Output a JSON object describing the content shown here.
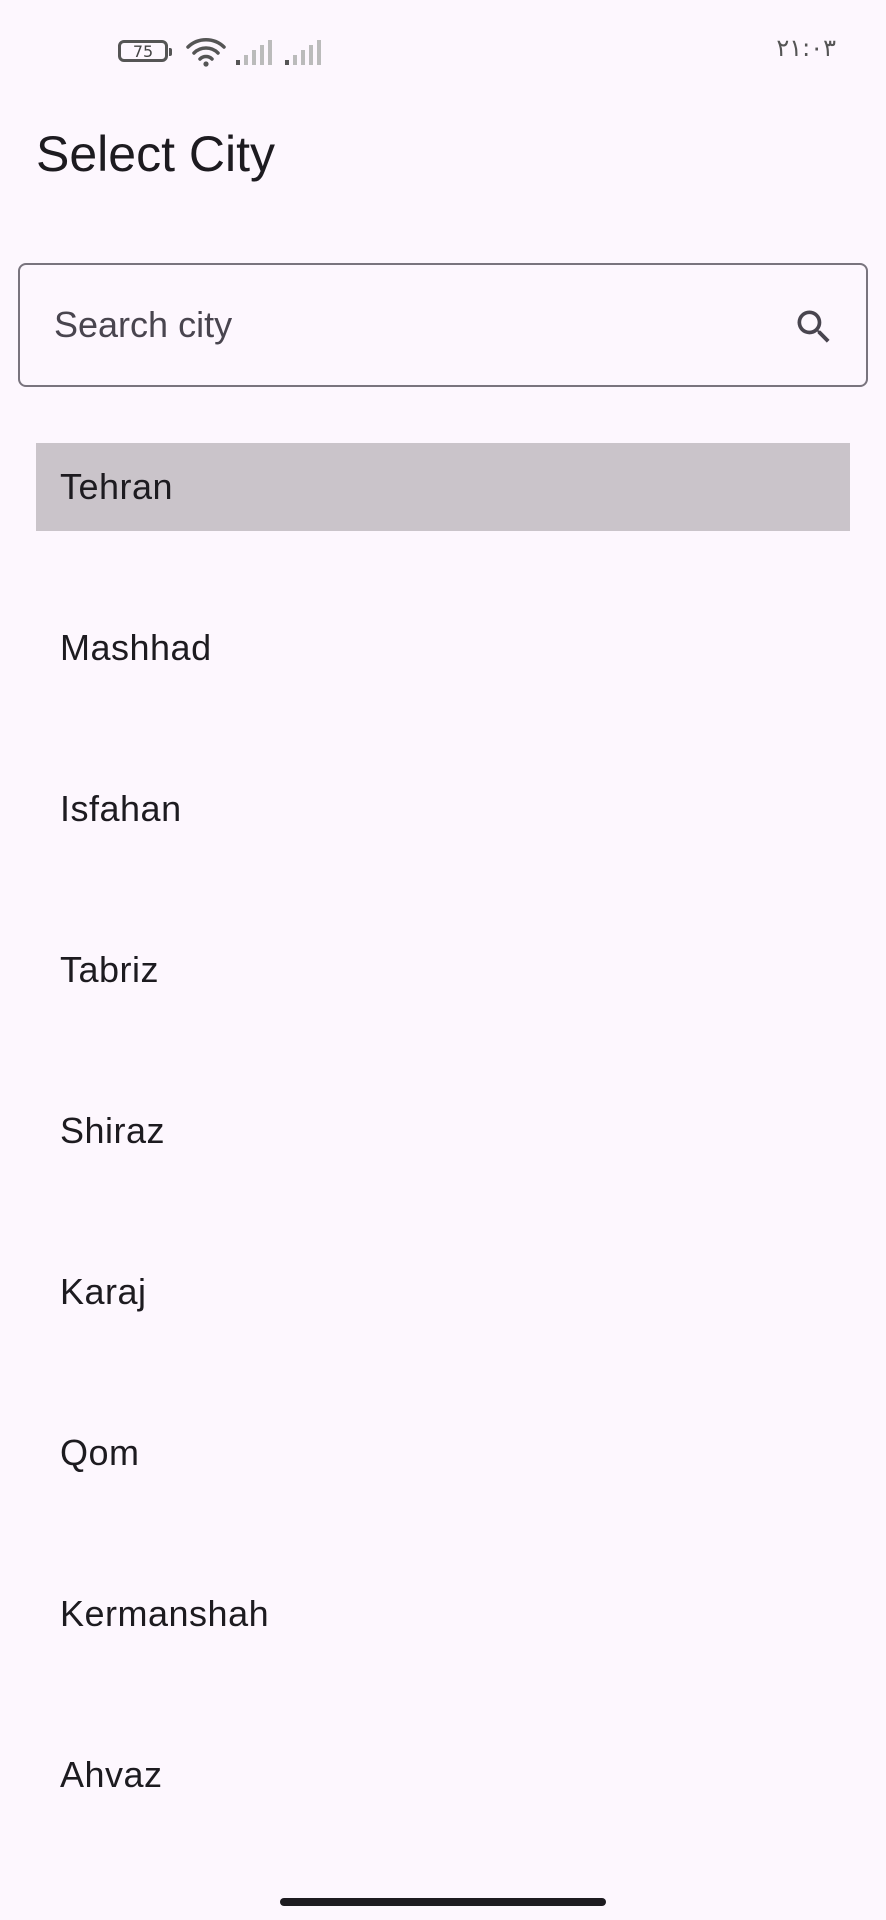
{
  "status_bar": {
    "battery_level": "75",
    "time": "۲۱:۰۳"
  },
  "header": {
    "title": "Select City"
  },
  "search": {
    "placeholder": "Search city",
    "value": ""
  },
  "cities": [
    {
      "name": "Tehran",
      "selected": true
    },
    {
      "name": "Mashhad",
      "selected": false
    },
    {
      "name": "Isfahan",
      "selected": false
    },
    {
      "name": "Tabriz",
      "selected": false
    },
    {
      "name": "Shiraz",
      "selected": false
    },
    {
      "name": "Karaj",
      "selected": false
    },
    {
      "name": "Qom",
      "selected": false
    },
    {
      "name": "Kermanshah",
      "selected": false
    },
    {
      "name": "Ahvaz",
      "selected": false
    }
  ],
  "colors": {
    "background": "#fdf7fe",
    "selected_row": "#cac4ca",
    "outline": "#79747e",
    "text": "#1d1b20"
  }
}
